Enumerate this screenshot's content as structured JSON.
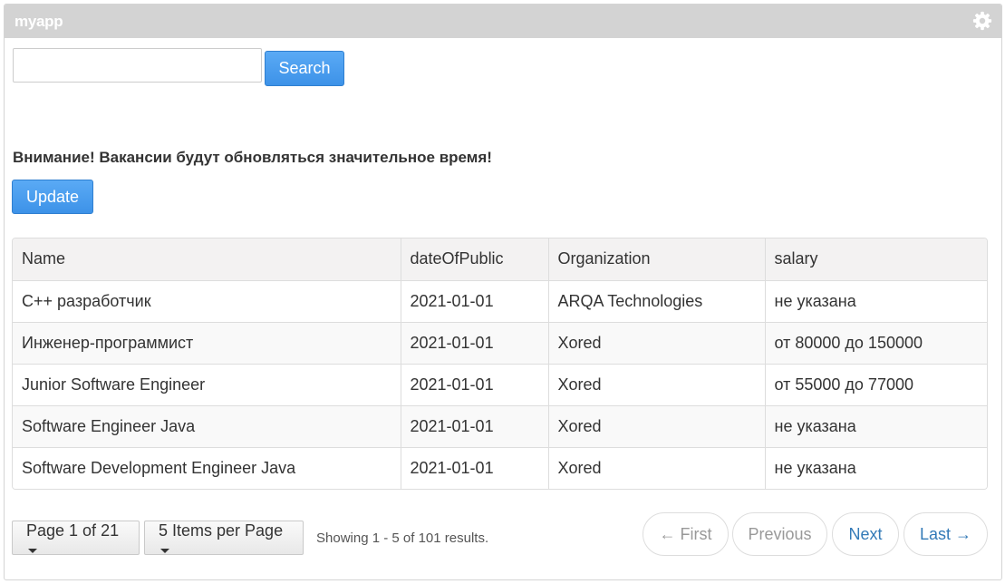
{
  "app": {
    "title": "myapp",
    "settings_icon": "gear-icon"
  },
  "search": {
    "value": "",
    "placeholder": "",
    "button_label": "Search"
  },
  "notice": {
    "text": "Внимание! Вакансии будут обновляться значительное время!"
  },
  "update": {
    "button_label": "Update"
  },
  "table": {
    "headers": [
      "Name",
      "dateOfPublic",
      "Organization",
      "salary"
    ],
    "rows": [
      [
        "C++ разработчик",
        "2021-01-01",
        "ARQA Technologies",
        "не указана"
      ],
      [
        "Инженер-программист",
        "2021-01-01",
        "Xored",
        "от 80000 до 150000"
      ],
      [
        "Junior Software Engineer",
        "2021-01-01",
        "Xored",
        "от 55000 до 77000"
      ],
      [
        "Software Engineer Java",
        "2021-01-01",
        "Xored",
        "не указана"
      ],
      [
        "Software Development Engineer Java",
        "2021-01-01",
        "Xored",
        "не указана"
      ]
    ]
  },
  "pagination": {
    "page_label": "Page 1 of 21",
    "items_label": "5 Items per Page",
    "results_text": "Showing 1 - 5 of 101 results.",
    "first_label": "← First",
    "previous_label": "Previous",
    "next_label": "Next",
    "last_label": "Last →"
  },
  "colors": {
    "header_bar": "#d3d3d3",
    "primary_button": "#4a9ff0",
    "link": "#337ab7"
  }
}
